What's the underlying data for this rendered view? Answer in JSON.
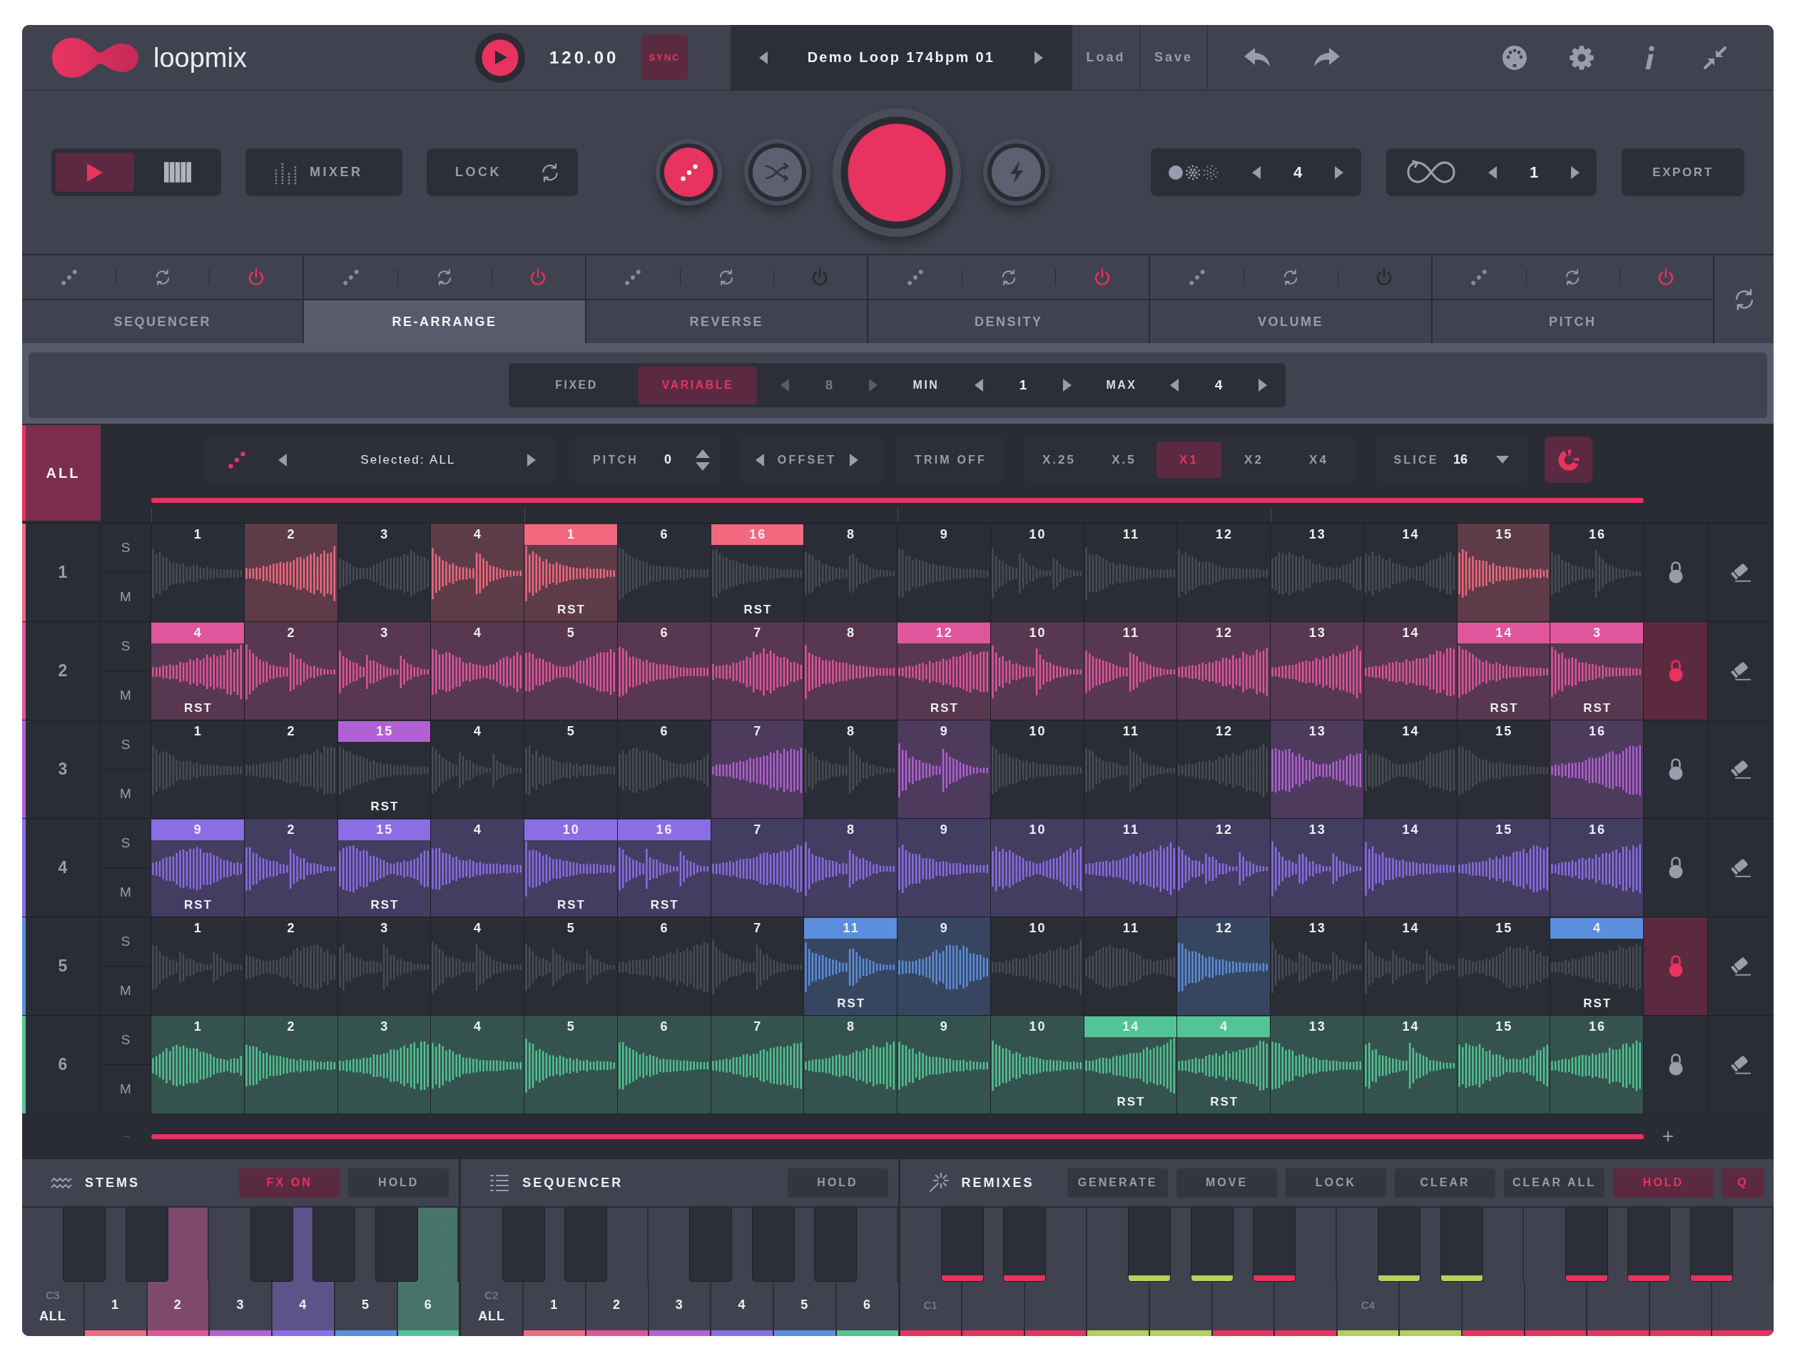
{
  "header": {
    "app_name": "loopmix",
    "tempo": "120.00",
    "sync": {
      "label": "SYNC",
      "on": true
    },
    "preset": "Demo Loop 174bpm 01",
    "file_buttons": [
      "Load",
      "Save"
    ]
  },
  "transport": {
    "modes": [
      {
        "kind": "play",
        "selected": true
      },
      {
        "kind": "keys",
        "selected": false
      }
    ],
    "mixer": "MIXER",
    "lock": "LOCK",
    "actions": [
      {
        "kind": "dice",
        "on": true
      },
      {
        "kind": "shuffle",
        "on": false
      },
      {
        "kind": "main",
        "on": true
      },
      {
        "kind": "bolt",
        "on": false
      }
    ],
    "density": "4",
    "loops": "1",
    "export": "EXPORT"
  },
  "effects": [
    {
      "label": "SEQUENCER",
      "selected": false,
      "power": true
    },
    {
      "label": "RE-ARRANGE",
      "selected": true,
      "power": true
    },
    {
      "label": "REVERSE",
      "selected": false,
      "power": false
    },
    {
      "label": "DENSITY",
      "selected": false,
      "power": true
    },
    {
      "label": "VOLUME",
      "selected": false,
      "power": false
    },
    {
      "label": "PITCH",
      "selected": false,
      "power": true
    }
  ],
  "options": {
    "modes": [
      {
        "label": "FIXED",
        "selected": false
      },
      {
        "label": "VARIABLE",
        "selected": true
      }
    ],
    "steps": {
      "value": "8",
      "disabled": true
    },
    "min": {
      "label": "MIN",
      "value": "1"
    },
    "max": {
      "label": "MAX",
      "value": "4"
    }
  },
  "toolbar": {
    "all": {
      "label": "ALL",
      "selected": true
    },
    "selection": "Selected: ALL",
    "pitch": {
      "label": "PITCH",
      "value": "0"
    },
    "offset": "OFFSET",
    "trim": "TRIM OFF",
    "speeds": [
      {
        "label": "X.25",
        "selected": false
      },
      {
        "label": "X.5",
        "selected": false
      },
      {
        "label": "X1",
        "selected": true
      },
      {
        "label": "X2",
        "selected": false
      },
      {
        "label": "X4",
        "selected": false
      }
    ],
    "slice": {
      "label": "SLICE",
      "value": "16"
    },
    "snap": {
      "on": true
    }
  },
  "tracks": [
    {
      "name": "1",
      "color": "#f2697f",
      "solo": "S",
      "mute": "M",
      "locked": false,
      "cells": [
        {
          "label": "1",
          "active": false,
          "remapped": false
        },
        {
          "label": "2",
          "active": true,
          "remapped": false
        },
        {
          "label": "3",
          "active": false,
          "remapped": false
        },
        {
          "label": "4",
          "active": true,
          "remapped": false
        },
        {
          "label": "1",
          "active": true,
          "remapped": true,
          "tag": "RST"
        },
        {
          "label": "6",
          "active": false,
          "remapped": false
        },
        {
          "label": "16",
          "active": false,
          "remapped": true,
          "tag": "RST"
        },
        {
          "label": "8",
          "active": false,
          "remapped": false
        },
        {
          "label": "9",
          "active": false,
          "remapped": false
        },
        {
          "label": "10",
          "active": false,
          "remapped": false
        },
        {
          "label": "11",
          "active": false,
          "remapped": false
        },
        {
          "label": "12",
          "active": false,
          "remapped": false
        },
        {
          "label": "13",
          "active": false,
          "remapped": false
        },
        {
          "label": "14",
          "active": false,
          "remapped": false
        },
        {
          "label": "15",
          "active": true,
          "remapped": false
        },
        {
          "label": "16",
          "active": false,
          "remapped": false
        }
      ]
    },
    {
      "name": "2",
      "color": "#e0569c",
      "solo": "S",
      "mute": "M",
      "locked": true,
      "cells": [
        {
          "label": "4",
          "active": true,
          "remapped": true,
          "tag": "RST"
        },
        {
          "label": "2",
          "active": true,
          "remapped": false
        },
        {
          "label": "3",
          "active": true,
          "remapped": false
        },
        {
          "label": "4",
          "active": true,
          "remapped": false
        },
        {
          "label": "5",
          "active": true,
          "remapped": false
        },
        {
          "label": "6",
          "active": true,
          "remapped": false
        },
        {
          "label": "7",
          "active": true,
          "remapped": false
        },
        {
          "label": "8",
          "active": true,
          "remapped": false
        },
        {
          "label": "12",
          "active": true,
          "remapped": true,
          "tag": "RST"
        },
        {
          "label": "10",
          "active": true,
          "remapped": false
        },
        {
          "label": "11",
          "active": true,
          "remapped": false
        },
        {
          "label": "12",
          "active": true,
          "remapped": false
        },
        {
          "label": "13",
          "active": true,
          "remapped": false
        },
        {
          "label": "14",
          "active": true,
          "remapped": false
        },
        {
          "label": "14",
          "active": true,
          "remapped": true,
          "tag": "RST"
        },
        {
          "label": "3",
          "active": true,
          "remapped": true,
          "tag": "RST"
        }
      ]
    },
    {
      "name": "3",
      "color": "#b261d3",
      "solo": "S",
      "mute": "M",
      "locked": false,
      "cells": [
        {
          "label": "1",
          "active": false,
          "remapped": false
        },
        {
          "label": "2",
          "active": false,
          "remapped": false
        },
        {
          "label": "15",
          "active": false,
          "remapped": true,
          "tag": "RST"
        },
        {
          "label": "4",
          "active": false,
          "remapped": false
        },
        {
          "label": "5",
          "active": false,
          "remapped": false
        },
        {
          "label": "6",
          "active": false,
          "remapped": false
        },
        {
          "label": "7",
          "active": true,
          "remapped": false
        },
        {
          "label": "8",
          "active": false,
          "remapped": false
        },
        {
          "label": "9",
          "active": true,
          "remapped": false
        },
        {
          "label": "10",
          "active": false,
          "remapped": false
        },
        {
          "label": "11",
          "active": false,
          "remapped": false
        },
        {
          "label": "12",
          "active": false,
          "remapped": false
        },
        {
          "label": "13",
          "active": true,
          "remapped": false
        },
        {
          "label": "14",
          "active": false,
          "remapped": false
        },
        {
          "label": "15",
          "active": false,
          "remapped": false
        },
        {
          "label": "16",
          "active": true,
          "remapped": false
        }
      ]
    },
    {
      "name": "4",
      "color": "#8b6ee6",
      "solo": "S",
      "mute": "M",
      "locked": false,
      "cells": [
        {
          "label": "9",
          "active": true,
          "remapped": true,
          "tag": "RST"
        },
        {
          "label": "2",
          "active": true,
          "remapped": false
        },
        {
          "label": "15",
          "active": true,
          "remapped": true,
          "tag": "RST"
        },
        {
          "label": "4",
          "active": true,
          "remapped": false
        },
        {
          "label": "10",
          "active": true,
          "remapped": true,
          "tag": "RST"
        },
        {
          "label": "16",
          "active": true,
          "remapped": true,
          "tag": "RST"
        },
        {
          "label": "7",
          "active": true,
          "remapped": false
        },
        {
          "label": "8",
          "active": true,
          "remapped": false
        },
        {
          "label": "9",
          "active": true,
          "remapped": false
        },
        {
          "label": "10",
          "active": true,
          "remapped": false
        },
        {
          "label": "11",
          "active": true,
          "remapped": false
        },
        {
          "label": "12",
          "active": true,
          "remapped": false
        },
        {
          "label": "13",
          "active": true,
          "remapped": false
        },
        {
          "label": "14",
          "active": true,
          "remapped": false
        },
        {
          "label": "15",
          "active": true,
          "remapped": false
        },
        {
          "label": "16",
          "active": true,
          "remapped": false
        }
      ]
    },
    {
      "name": "5",
      "color": "#5b8fdd",
      "solo": "S",
      "mute": "M",
      "locked": true,
      "cells": [
        {
          "label": "1",
          "active": false,
          "remapped": false
        },
        {
          "label": "2",
          "active": false,
          "remapped": false
        },
        {
          "label": "3",
          "active": false,
          "remapped": false
        },
        {
          "label": "4",
          "active": false,
          "remapped": false
        },
        {
          "label": "5",
          "active": false,
          "remapped": false
        },
        {
          "label": "6",
          "active": false,
          "remapped": false
        },
        {
          "label": "7",
          "active": false,
          "remapped": false
        },
        {
          "label": "11",
          "active": true,
          "remapped": true,
          "tag": "RST"
        },
        {
          "label": "9",
          "active": true,
          "remapped": false
        },
        {
          "label": "10",
          "active": false,
          "remapped": false
        },
        {
          "label": "11",
          "active": false,
          "remapped": false
        },
        {
          "label": "12",
          "active": true,
          "remapped": false
        },
        {
          "label": "13",
          "active": false,
          "remapped": false
        },
        {
          "label": "14",
          "active": false,
          "remapped": false
        },
        {
          "label": "15",
          "active": false,
          "remapped": false
        },
        {
          "label": "4",
          "active": false,
          "remapped": true,
          "tag": "RST"
        }
      ]
    },
    {
      "name": "6",
      "color": "#53c495",
      "solo": "S",
      "mute": "M",
      "locked": false,
      "cells": [
        {
          "label": "1",
          "active": true,
          "remapped": false
        },
        {
          "label": "2",
          "active": true,
          "remapped": false
        },
        {
          "label": "3",
          "active": true,
          "remapped": false
        },
        {
          "label": "4",
          "active": true,
          "remapped": false
        },
        {
          "label": "5",
          "active": true,
          "remapped": false
        },
        {
          "label": "6",
          "active": true,
          "remapped": false
        },
        {
          "label": "7",
          "active": true,
          "remapped": false
        },
        {
          "label": "8",
          "active": true,
          "remapped": false
        },
        {
          "label": "9",
          "active": true,
          "remapped": false
        },
        {
          "label": "10",
          "active": true,
          "remapped": false
        },
        {
          "label": "14",
          "active": true,
          "remapped": true,
          "tag": "RST"
        },
        {
          "label": "4",
          "active": true,
          "remapped": true,
          "tag": "RST"
        },
        {
          "label": "13",
          "active": true,
          "remapped": false
        },
        {
          "label": "14",
          "active": true,
          "remapped": false
        },
        {
          "label": "15",
          "active": true,
          "remapped": false
        },
        {
          "label": "16",
          "active": true,
          "remapped": false
        }
      ]
    }
  ],
  "zoom": {
    "out": "−",
    "in": "+"
  },
  "panels": [
    {
      "kind": "stems",
      "title": "STEMS",
      "buttons": [
        {
          "label": "FX ON",
          "on": true
        },
        {
          "label": "HOLD",
          "on": false
        }
      ],
      "keys": [
        {
          "note": "C3",
          "label": "ALL",
          "selected": false
        },
        {
          "label": "1",
          "color": "#f2697f",
          "selected": false
        },
        {
          "label": "2",
          "color": "#e0569c",
          "selected": true
        },
        {
          "label": "3",
          "color": "#b261d3",
          "selected": false
        },
        {
          "label": "4",
          "color": "#8b6ee6",
          "selected": true
        },
        {
          "label": "5",
          "color": "#5b8fdd",
          "selected": false
        },
        {
          "label": "6",
          "color": "#53c495",
          "selected": true
        }
      ]
    },
    {
      "kind": "sequencer",
      "title": "SEQUENCER",
      "buttons": [
        {
          "label": "HOLD",
          "on": false
        }
      ],
      "keys": [
        {
          "note": "C2",
          "label": "ALL",
          "selected": false
        },
        {
          "label": "1",
          "color": "#f2697f",
          "selected": false
        },
        {
          "label": "2",
          "color": "#e0569c",
          "selected": false
        },
        {
          "label": "3",
          "color": "#b261d3",
          "selected": false
        },
        {
          "label": "4",
          "color": "#8b6ee6",
          "selected": false
        },
        {
          "label": "5",
          "color": "#5b8fdd",
          "selected": false
        },
        {
          "label": "6",
          "color": "#53c495",
          "selected": false
        }
      ]
    },
    {
      "kind": "remixes",
      "title": "REMIXES",
      "buttons": [
        {
          "label": "GENERATE",
          "on": false
        },
        {
          "label": "MOVE",
          "on": false
        },
        {
          "label": "LOCK",
          "on": false
        },
        {
          "label": "CLEAR",
          "on": false
        },
        {
          "label": "CLEAR ALL",
          "on": false
        },
        {
          "label": "HOLD",
          "on": true
        },
        {
          "label": "Q",
          "on": true
        }
      ],
      "keys": [
        {
          "note": "C1",
          "color": "#e8325f"
        },
        {
          "color": "#e8325f"
        },
        {
          "color": "#e8325f"
        },
        {
          "color": "#b4cf5c"
        },
        {
          "color": "#b4cf5c"
        },
        {
          "color": "#e8325f"
        },
        {
          "color": "#e8325f"
        },
        {
          "note": "C4",
          "color": "#b4cf5c"
        },
        {
          "color": "#b4cf5c"
        },
        {
          "color": "#e8325f"
        },
        {
          "color": "#e8325f"
        },
        {
          "color": "#e8325f"
        },
        {
          "color": "#e8325f"
        },
        {
          "color": "#e8325f"
        }
      ],
      "black_keys": [
        {
          "color": "#e8325f"
        },
        {
          "color": "#e8325f"
        },
        {
          "color": "#b4cf5c"
        },
        {
          "color": "#b4cf5c"
        },
        {
          "color": "#e8325f"
        },
        {
          "color": "#b4cf5c"
        },
        {
          "color": "#b4cf5c"
        },
        {
          "color": "#e8325f"
        },
        {
          "color": "#e8325f"
        },
        {
          "color": "#e8325f"
        }
      ]
    }
  ]
}
